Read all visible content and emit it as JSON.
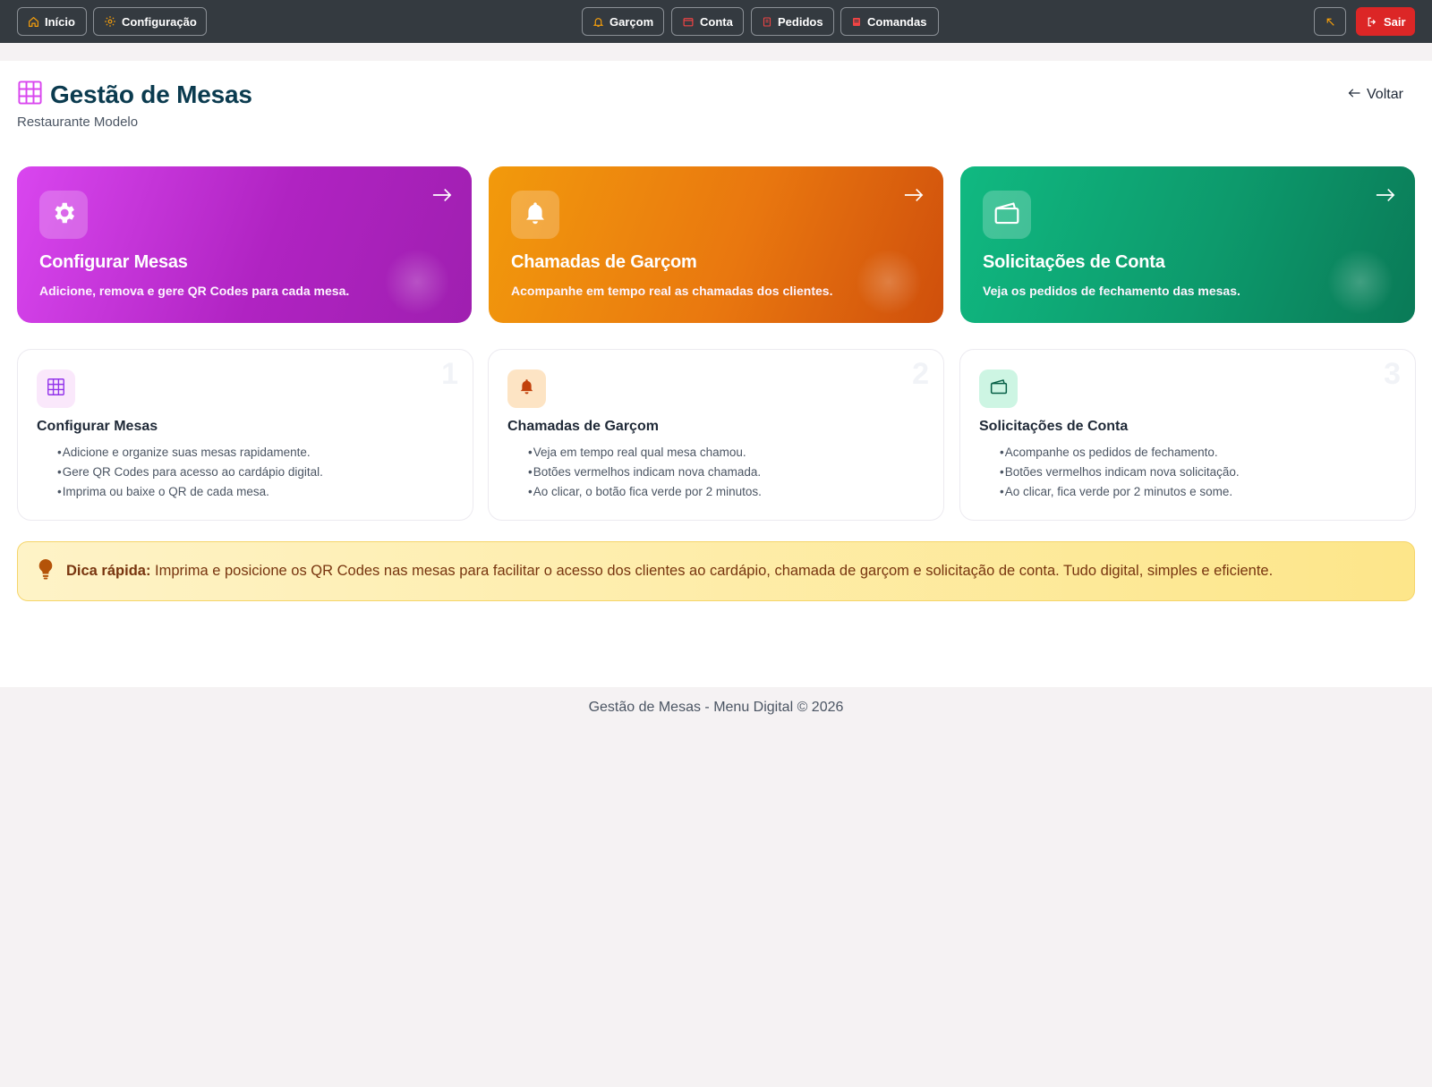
{
  "nav": {
    "inicio": "Início",
    "configuracao": "Configuração",
    "garcom": "Garçom",
    "conta": "Conta",
    "pedidos": "Pedidos",
    "comandas": "Comandas",
    "sair": "Sair"
  },
  "header": {
    "title": "Gestão de Mesas",
    "subtitle": "Restaurante Modelo",
    "back": "Voltar"
  },
  "features": [
    {
      "title": "Configurar Mesas",
      "desc": "Adicione, remova e gere QR Codes para cada mesa.",
      "icon": "gear-icon",
      "color": "#c026d3"
    },
    {
      "title": "Chamadas de Garçom",
      "desc": "Acompanhe em tempo real as chamadas dos clientes.",
      "icon": "bell-icon",
      "color": "#ea7a10"
    },
    {
      "title": "Solicitações de Conta",
      "desc": "Veja os pedidos de fechamento das mesas.",
      "icon": "wallet-icon",
      "color": "#0e9f6e"
    }
  ],
  "info": [
    {
      "num": "1",
      "title": "Configurar Mesas",
      "items": [
        "Adicione e organize suas mesas rapidamente.",
        "Gere QR Codes para acesso ao cardápio digital.",
        "Imprima ou baixe o QR de cada mesa."
      ]
    },
    {
      "num": "2",
      "title": "Chamadas de Garçom",
      "items": [
        "Veja em tempo real qual mesa chamou.",
        "Botões vermelhos indicam nova chamada.",
        "Ao clicar, o botão fica verde por 2 minutos."
      ]
    },
    {
      "num": "3",
      "title": "Solicitações de Conta",
      "items": [
        "Acompanhe os pedidos de fechamento.",
        "Botões vermelhos indicam nova solicitação.",
        "Ao clicar, fica verde por 2 minutos e some."
      ]
    }
  ],
  "tip": {
    "label": "Dica rápida:",
    "text": " Imprima e posicione os QR Codes nas mesas para facilitar o acesso dos clientes ao cardápio, chamada de garçom e solicitação de conta. Tudo digital, simples e eficiente."
  },
  "footer": "Gestão de Mesas - Menu Digital © 2026"
}
